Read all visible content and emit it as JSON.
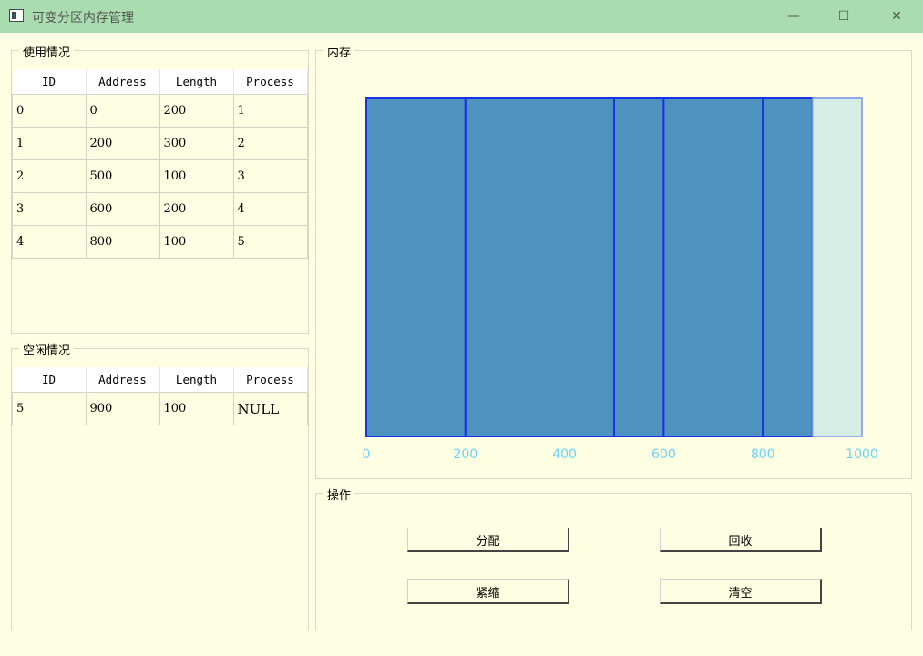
{
  "window": {
    "title": "可变分区内存管理",
    "minimize_glyph": "—",
    "maximize_glyph": "☐",
    "close_glyph": "✕"
  },
  "used_panel": {
    "label": "使用情况",
    "columns": [
      "ID",
      "Address",
      "Length",
      "Process"
    ],
    "rows": [
      [
        "0",
        "0",
        "200",
        "1"
      ],
      [
        "1",
        "200",
        "300",
        "2"
      ],
      [
        "2",
        "500",
        "100",
        "3"
      ],
      [
        "3",
        "600",
        "200",
        "4"
      ],
      [
        "4",
        "800",
        "100",
        "5"
      ]
    ]
  },
  "free_panel": {
    "label": "空闲情况",
    "columns": [
      "ID",
      "Address",
      "Length",
      "Process"
    ],
    "rows": [
      [
        "5",
        "900",
        "100",
        "NULL"
      ]
    ]
  },
  "memory_panel": {
    "label": "内存"
  },
  "chart_data": {
    "type": "bar",
    "orientation": "stacked-horizontal-segments",
    "xlim": [
      0,
      1000
    ],
    "x_ticks": [
      "0",
      "200",
      "400",
      "600",
      "800",
      "1000"
    ],
    "segments": [
      {
        "start": 0,
        "length": 200,
        "state": "used"
      },
      {
        "start": 200,
        "length": 300,
        "state": "used"
      },
      {
        "start": 500,
        "length": 100,
        "state": "used"
      },
      {
        "start": 600,
        "length": 200,
        "state": "used"
      },
      {
        "start": 800,
        "length": 100,
        "state": "used"
      },
      {
        "start": 900,
        "length": 100,
        "state": "free"
      }
    ],
    "colors": {
      "used": "#4e92bf",
      "free": "#d6ede6",
      "border": "#1a32e6",
      "tick": "#6dd3f3"
    }
  },
  "ops_panel": {
    "label": "操作",
    "allocate": "分配",
    "reclaim": "回收",
    "compact": "紧缩",
    "clear": "清空"
  }
}
